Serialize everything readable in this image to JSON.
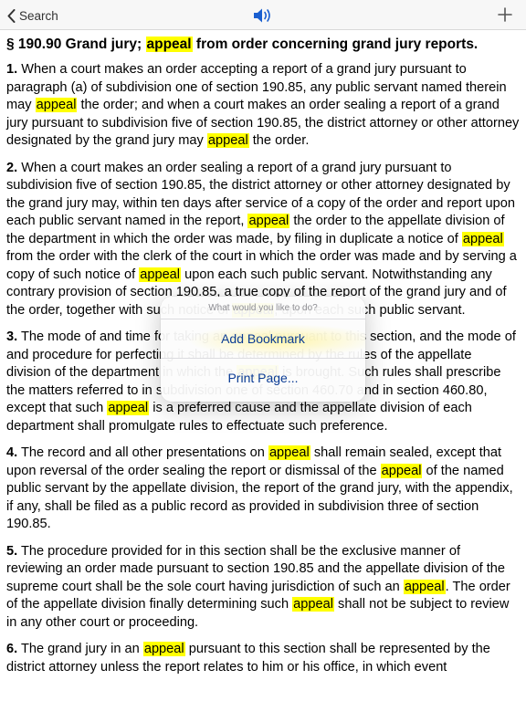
{
  "nav": {
    "back_label": "Search",
    "back_icon": "chevron-left-icon",
    "speaker_icon": "speaker-icon",
    "add_icon": "plus-icon",
    "accent_color": "#1a5fd0"
  },
  "document": {
    "heading": {
      "prefix": "§ 190.90 Grand jury; ",
      "highlight": "appeal",
      "suffix": " from order concerning grand jury reports."
    },
    "highlight_color": "#ffff00",
    "paragraphs": [
      {
        "number": "1.",
        "segments": [
          {
            "t": " When a court makes an order accepting a report of a grand jury pursuant to paragraph (a) of subdivision one of section 190.85, any public servant named therein may "
          },
          {
            "t": "appeal",
            "hl": true
          },
          {
            "t": " the order; and when a court makes an order sealing a report of a grand jury pursuant to subdivision five of section 190.85, the district attorney or other attorney designated by the grand jury may "
          },
          {
            "t": "appeal",
            "hl": true
          },
          {
            "t": " the order."
          }
        ]
      },
      {
        "number": "2.",
        "segments": [
          {
            "t": " When a court makes an order sealing a report of a grand jury pursuant to subdivision five of section 190.85, the district attorney or other attorney designated by the grand jury may, within ten days after service of a copy of the order and report upon each public servant named in the report, "
          },
          {
            "t": "appeal",
            "hl": true
          },
          {
            "t": " the order to the appellate division of the department in which the order was made, by filing in duplicate a notice of "
          },
          {
            "t": "appeal",
            "hl": true
          },
          {
            "t": " from the order with the clerk of the court in which the order was made and by serving a copy of such notice of "
          },
          {
            "t": "appeal",
            "hl": true
          },
          {
            "t": " upon each such public servant. Notwithstanding any contrary provision of section 190.85, a true copy of the report of the grand jury and of the order, together with such notice of "
          },
          {
            "t": "appeal",
            "hl": true
          },
          {
            "t": ", upon each such public servant."
          }
        ]
      },
      {
        "number": "3.",
        "segments": [
          {
            "t": " The mode of and time for taking an appeal pursuant to this section, and the mode of and procedure for perfecting it shall be determined by the rules of the appellate division of the department in which the "
          },
          {
            "t": "appeal",
            "hl": true
          },
          {
            "t": " is brought. Such rules shall prescribe the matters referred to in subdivision one of section 460.70 and in section 460.80, except that such "
          },
          {
            "t": "appeal",
            "hl": true
          },
          {
            "t": " is a preferred cause and the appellate division of each department shall promulgate rules to effectuate such preference."
          }
        ]
      },
      {
        "number": "4.",
        "segments": [
          {
            "t": " The record and all other presentations on "
          },
          {
            "t": "appeal",
            "hl": true
          },
          {
            "t": " shall remain sealed, except that upon reversal of the order sealing the report or dismissal of the "
          },
          {
            "t": "appeal",
            "hl": true
          },
          {
            "t": " of the named public servant by the appellate division, the report of the grand jury, with the appendix, if any, shall be filed as a public record as provided in subdivision three of section 190.85."
          }
        ]
      },
      {
        "number": "5.",
        "segments": [
          {
            "t": " The procedure provided for in this section shall be the exclusive manner of reviewing an order made pursuant to section 190.85 and the appellate division of the supreme court shall be the sole court having jurisdiction of such an "
          },
          {
            "t": "appeal",
            "hl": true
          },
          {
            "t": ". The order of the appellate division finally determining such "
          },
          {
            "t": "appeal",
            "hl": true
          },
          {
            "t": " shall not be subject to review in any other court or proceeding."
          }
        ]
      },
      {
        "number": "6.",
        "segments": [
          {
            "t": " The grand jury in an "
          },
          {
            "t": "appeal",
            "hl": true
          },
          {
            "t": " pursuant to this section shall be represented by the district attorney unless the report relates to him or his office, in which event"
          }
        ]
      }
    ]
  },
  "popover": {
    "title": "What would you like to do?",
    "items": [
      "Add Bookmark",
      "Print Page..."
    ]
  }
}
